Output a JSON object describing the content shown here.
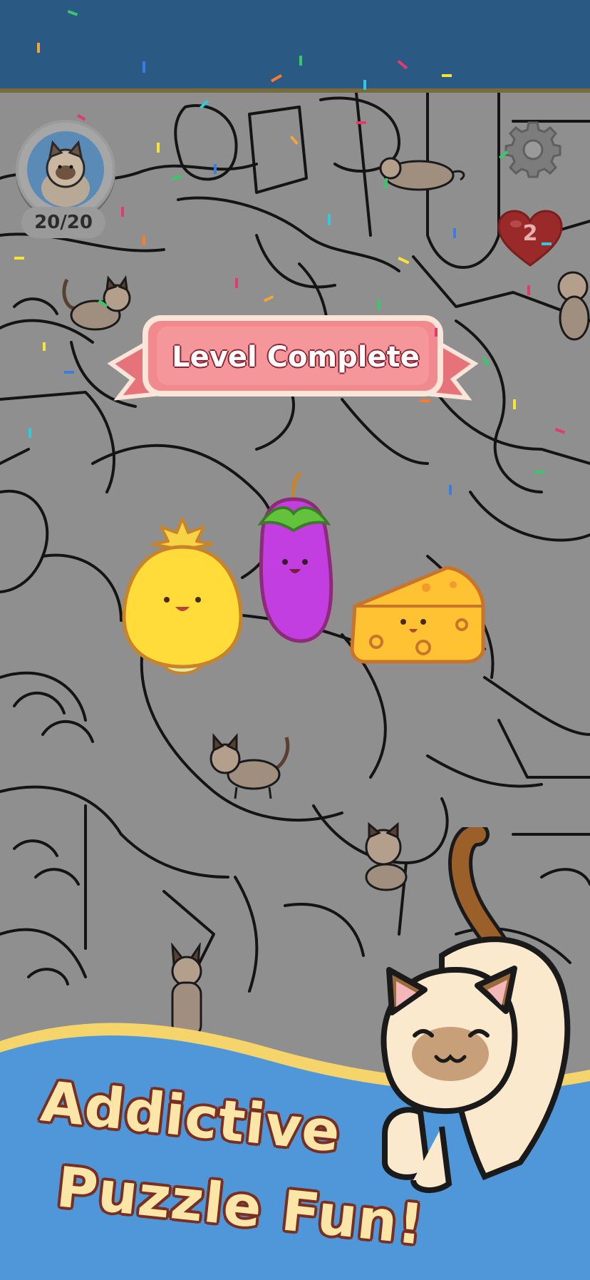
{
  "hud": {
    "cats_found": "20/20",
    "lives": "2"
  },
  "banner": {
    "title": "Level Complete"
  },
  "promo": {
    "line1": "Addictive",
    "line2": "Puzzle Fun!"
  },
  "colors": {
    "top_bar": "#2a5a83",
    "background": "#8f8f8f",
    "banner": "#f07a7f",
    "wave_blue": "#4f97d9",
    "wave_yellow": "#f5d56b",
    "tagline_fill": "#fbe6a8",
    "tagline_outline": "#7a2e22"
  },
  "icons": {
    "settings": "gear-icon",
    "lives": "heart-icon"
  }
}
